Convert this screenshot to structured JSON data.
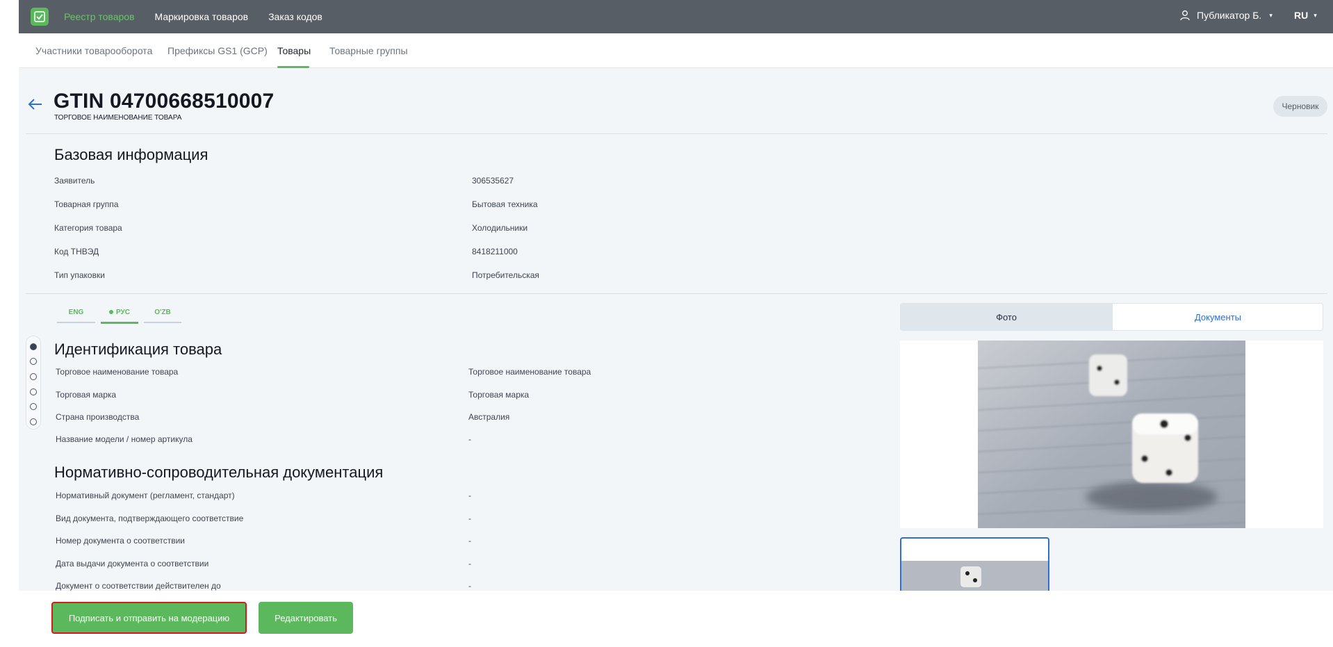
{
  "topbar": {
    "nav": [
      "Реестр товаров",
      "Маркировка товаров",
      "Заказ кодов"
    ],
    "user_name": "Публикатор Б.",
    "language": "RU"
  },
  "tabs": [
    "Участники товарооборота",
    "Префиксы GS1 (GCP)",
    "Товары",
    "Товарные группы"
  ],
  "header": {
    "title": "GTIN 04700668510007",
    "subtitle": "ТОРГОВОЕ НАИМЕНОВАНИЕ ТОВАРА",
    "status": "Черновик"
  },
  "basic": {
    "title": "Базовая информация",
    "rows": [
      {
        "label": "Заявитель",
        "value": "306535627"
      },
      {
        "label": "Товарная группа",
        "value": "Бытовая техника"
      },
      {
        "label": "Категория товара",
        "value": "Холодильники"
      },
      {
        "label": "Код ТНВЭД",
        "value": "8418211000"
      },
      {
        "label": "Тип упаковки",
        "value": "Потребительская"
      }
    ]
  },
  "language_tabs": [
    "ENG",
    "РУС",
    "O'ZB"
  ],
  "identification": {
    "title": "Идентификация товара",
    "rows": [
      {
        "label": "Торговое наименование товара",
        "value": "Торговое наименование товара"
      },
      {
        "label": "Торговая марка",
        "value": "Торговая марка"
      },
      {
        "label": "Страна производства",
        "value": "Австралия"
      },
      {
        "label": "Название модели / номер артикула",
        "value": "-"
      }
    ]
  },
  "docs": {
    "title": "Нормативно-сопроводительная документация",
    "rows": [
      {
        "label": "Нормативный документ (регламент, стандарт)",
        "value": "-"
      },
      {
        "label": "Вид документа, подтверждающего соответствие",
        "value": "-"
      },
      {
        "label": "Номер документа о соответствии",
        "value": "-"
      },
      {
        "label": "Дата выдачи документа о соответствии",
        "value": "-"
      },
      {
        "label": "Документ о соответствии действителен до",
        "value": "-"
      }
    ]
  },
  "media": {
    "tabs": [
      "Фото",
      "Документы"
    ]
  },
  "footer": {
    "sign_button": "Подписать и отправить на модерацию",
    "edit_button": "Редактировать"
  },
  "colors": {
    "accent": "#5cb85c",
    "topbar": "#575e66",
    "highlight_border": "#e0141c",
    "link_blue": "#2f6fd0"
  }
}
